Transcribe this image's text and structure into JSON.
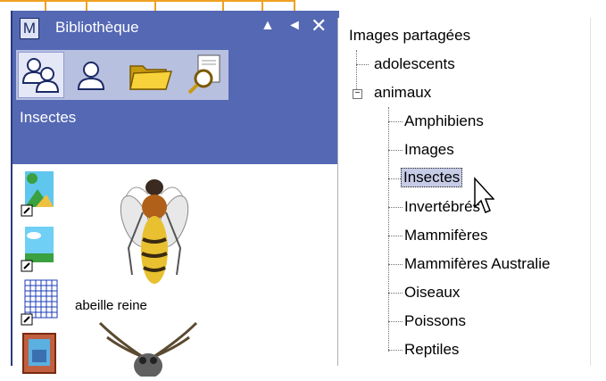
{
  "window": {
    "title": "Bibliothèque",
    "m_button_label": "M",
    "controls": {
      "collapse": "▲",
      "back": "◄",
      "close": "✕"
    }
  },
  "toolbar": {
    "icons": [
      "group-users-icon",
      "user-icon",
      "folder-icon",
      "search-document-icon"
    ]
  },
  "current_category": "Insectes",
  "thumbnails": {
    "items": [
      {
        "name": "landscape-thumbnail",
        "icon": "landscape-icon"
      },
      {
        "name": "sky-thumbnail",
        "icon": "landscape-icon"
      },
      {
        "name": "grid-thumbnail",
        "icon": "grid-icon"
      },
      {
        "name": "frame-thumbnail",
        "icon": "picture-frame-icon"
      }
    ],
    "bee_label": "abeille reine"
  },
  "tree": {
    "root": "Images partagées",
    "nodes": [
      {
        "label": "adolescents"
      },
      {
        "label": "animaux",
        "expanded": true
      },
      {
        "label": "Amphibiens"
      },
      {
        "label": "Images"
      },
      {
        "label": "Insectes",
        "selected": true
      },
      {
        "label": "Invertébrés"
      },
      {
        "label": "Mammifères"
      },
      {
        "label": "Mammifères Australie"
      },
      {
        "label": "Oiseaux"
      },
      {
        "label": "Poissons"
      },
      {
        "label": "Reptiles"
      }
    ]
  },
  "colors": {
    "panel": "#5468b4",
    "toolbar": "#b8c0e0",
    "selection": "#c6cce6",
    "callout": "#f0a020"
  }
}
